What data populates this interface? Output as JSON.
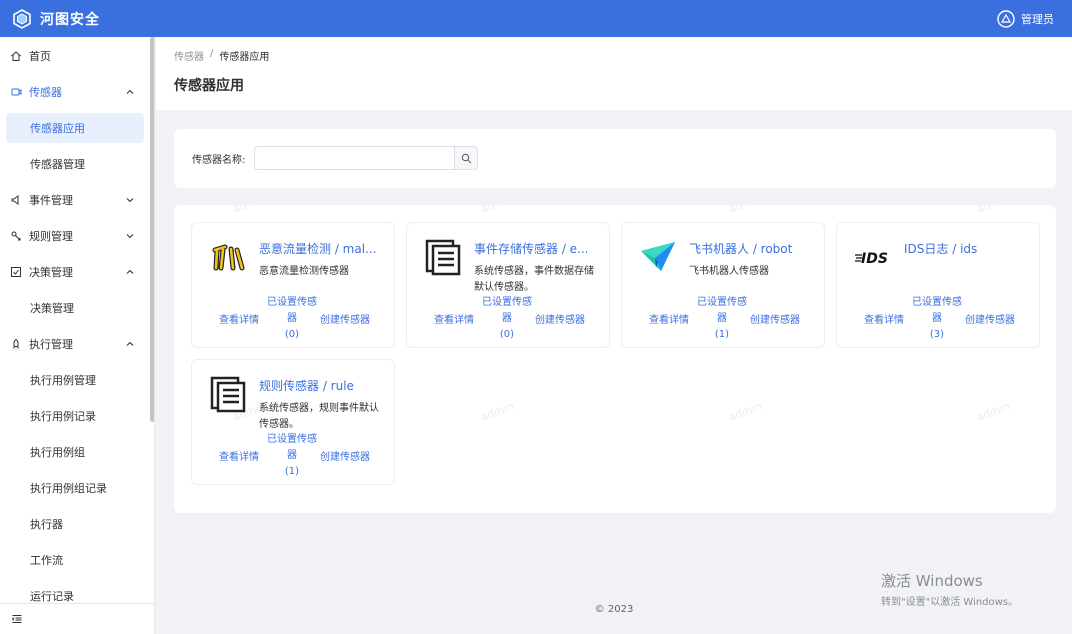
{
  "app": {
    "title": "河图安全",
    "user": "管理员"
  },
  "sidebar": {
    "items": [
      {
        "label": "首页",
        "icon": "home-icon"
      },
      {
        "label": "传感器",
        "icon": "sensor-icon"
      },
      {
        "label": "传感器应用"
      },
      {
        "label": "传感器管理"
      },
      {
        "label": "事件管理",
        "icon": "event-icon"
      },
      {
        "label": "规则管理",
        "icon": "rule-icon"
      },
      {
        "label": "决策管理",
        "icon": "decision-icon"
      },
      {
        "label": "决策管理"
      },
      {
        "label": "执行管理",
        "icon": "execute-icon"
      },
      {
        "label": "执行用例管理"
      },
      {
        "label": "执行用例记录"
      },
      {
        "label": "执行用例组"
      },
      {
        "label": "执行用例组记录"
      },
      {
        "label": "执行器"
      },
      {
        "label": "工作流"
      },
      {
        "label": "运行记录"
      }
    ]
  },
  "breadcrumb": [
    "传感器",
    "传感器应用"
  ],
  "breadcrumb_sep": "/",
  "page_title": "传感器应用",
  "search": {
    "label": "传感器名称:",
    "placeholder": ""
  },
  "sensors": [
    {
      "title": "恶意流量检测 / mal...",
      "desc": "恶意流量检测传感器",
      "detail": "查看详情",
      "set": "已设置传感器",
      "count": "(0)",
      "create": "创建传感器",
      "icon": "malware-claw-icon"
    },
    {
      "title": "事件存储传感器 / e...",
      "desc": "系统传感器，事件数据存储默认传感器。",
      "detail": "查看详情",
      "set": "已设置传感器",
      "count": "(0)",
      "create": "创建传感器",
      "icon": "document-list-icon"
    },
    {
      "title": "飞书机器人 / robot",
      "desc": "飞书机器人传感器",
      "detail": "查看详情",
      "set": "已设置传感器",
      "count": "(1)",
      "create": "创建传感器",
      "icon": "feishu-paper-plane-icon"
    },
    {
      "title": "IDS日志 / ids",
      "desc": "",
      "detail": "查看详情",
      "set": "已设置传感器",
      "count": "(3)",
      "create": "创建传感器",
      "icon": "ids-logo-icon"
    },
    {
      "title": "规则传感器 / rule",
      "desc": "系统传感器，规则事件默认传感器。",
      "detail": "查看详情",
      "set": "已设置传感器",
      "count": "(1)",
      "create": "创建传感器",
      "icon": "document-list-icon"
    }
  ],
  "watermark": "admin",
  "copyright": "© 2023",
  "windows_activation": {
    "line1": "激活 Windows",
    "line2": "转到\"设置\"以激活 Windows。"
  },
  "colors": {
    "primary": "#3a6fe0",
    "header_bg": "#3a6fe0",
    "page_bg": "#f0f2f5"
  }
}
